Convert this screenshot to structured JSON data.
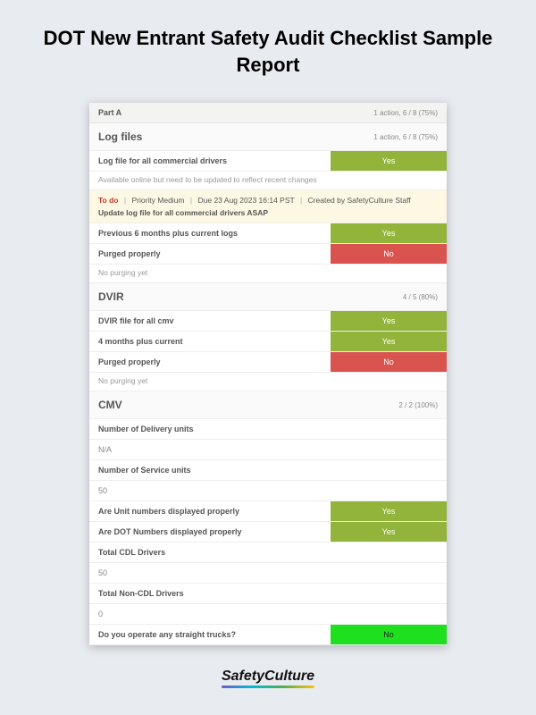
{
  "title": "DOT New Entrant Safety Audit Checklist Sample Report",
  "partA": {
    "label": "Part A",
    "stats": "1 action, 6 / 8 (75%)"
  },
  "logFiles": {
    "title": "Log files",
    "stats": "1 action, 6 / 8 (75%)",
    "items": {
      "logFileAll": {
        "label": "Log file for all commercial drivers",
        "badge": "Yes"
      },
      "note": "Available online but need to be updated to reflect recent changes",
      "todo": {
        "tag": "To do",
        "priority": "Priority Medium",
        "due": "Due 23 Aug 2023 16:14 PST",
        "creator": "Created by SafetyCulture Staff",
        "task": "Update log file for all commercial drivers ASAP"
      },
      "prev6": {
        "label": "Previous 6 months  plus current logs",
        "badge": "Yes"
      },
      "purged": {
        "label": "Purged properly",
        "badge": "No"
      },
      "purgedNote": "No purging yet"
    }
  },
  "dvir": {
    "title": "DVIR",
    "stats": "4 / 5 (80%)",
    "items": {
      "file": {
        "label": "DVIR file for all cmv",
        "badge": "Yes"
      },
      "four": {
        "label": "4 months plus current",
        "badge": "Yes"
      },
      "purged": {
        "label": "Purged properly",
        "badge": "No"
      },
      "purgedNote": "No purging yet"
    }
  },
  "cmv": {
    "title": "CMV",
    "stats": "2 / 2 (100%)",
    "items": {
      "deliveryLabel": "Number of Delivery units",
      "deliveryVal": "N/A",
      "serviceLabel": "Number of Service units",
      "serviceVal": "50",
      "unitNums": {
        "label": "Are Unit numbers displayed properly",
        "badge": "Yes"
      },
      "dotNums": {
        "label": "Are DOT Numbers displayed properly",
        "badge": "Yes"
      },
      "cdlLabel": "Total CDL Drivers",
      "cdlVal": "50",
      "nonCdlLabel": "Total Non-CDL Drivers",
      "nonCdlVal": "0",
      "straight": {
        "label": "Do you operate any straight trucks?",
        "badge": "No"
      }
    }
  },
  "brand": "SafetyCulture"
}
